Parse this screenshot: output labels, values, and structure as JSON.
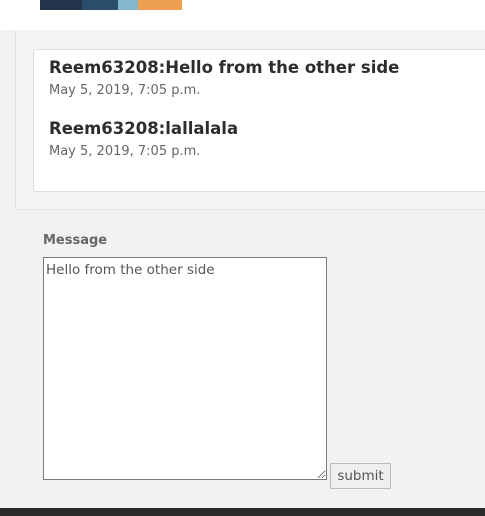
{
  "banner": {
    "colors": [
      "#22334a",
      "#2a4d6b",
      "#84b6cf",
      "#ef9f52"
    ]
  },
  "messages": [
    {
      "text": "Reem63208:Hello from the other side",
      "time": "May 5, 2019, 7:05 p.m."
    },
    {
      "text": "Reem63208:lallalala",
      "time": "May 5, 2019, 7:05 p.m."
    }
  ],
  "form": {
    "label": "Message",
    "textarea_value": "Hello from the other side",
    "submit_label": "submit"
  }
}
